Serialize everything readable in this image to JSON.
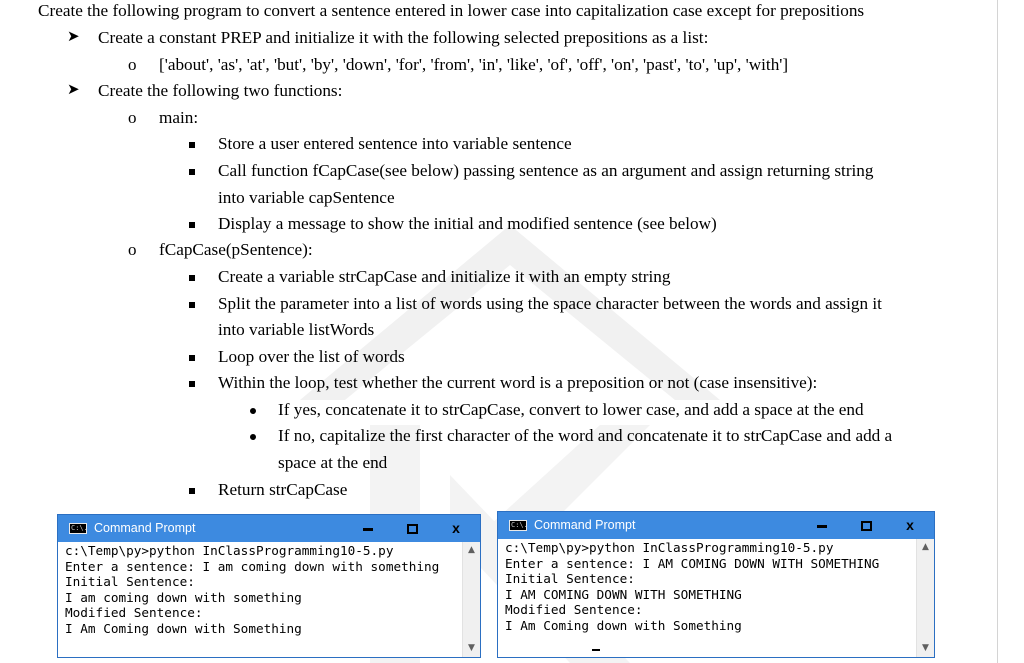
{
  "heading": "Create the following program to convert a sentence entered in lower case into capitalization case except for prepositions",
  "steps": [
    "Create a constant PREP and initialize it with the following selected prepositions as a list:",
    "Create the following two functions:"
  ],
  "prep_list": "['about', 'as', 'at', 'but', 'by', 'down', 'for', 'from', 'in', 'like', 'of', 'off', 'on', 'past', 'to', 'up', 'with']",
  "main": {
    "title": "main:",
    "items": [
      "Store a user entered sentence into variable sentence",
      "Call function fCapCase(see below) passing sentence as an argument and assign returning string",
      "into variable capSentence",
      "Display a message to show the initial and modified sentence (see below)"
    ]
  },
  "fcap": {
    "title": "fCapCase(pSentence):",
    "items": [
      "Create a variable strCapCase and initialize it with an empty string",
      "Split the parameter into a list of words using the space character between the words and assign it",
      "into variable listWords",
      "Loop over the list of words",
      "Within the loop, test whether the current word is a preposition or not (case insensitive):",
      "Return strCapCase"
    ],
    "sub": [
      "If yes, concatenate it to strCapCase, convert to lower case, and add a space at the end",
      "If no, capitalize the first character of the word and concatenate it to strCapCase and add a",
      "space at the end"
    ]
  },
  "console_left": {
    "title": "Command Prompt",
    "icon_text": "C:\\.",
    "lines": [
      "c:\\Temp\\py>python InClassProgramming10-5.py",
      "Enter a sentence: I am coming down with something",
      "Initial Sentence:",
      "I am coming down with something",
      "Modified Sentence:",
      "I Am Coming down with Something"
    ]
  },
  "console_right": {
    "title": "Command Prompt",
    "icon_text": "C:\\.",
    "lines": [
      "c:\\Temp\\py>python InClassProgramming10-5.py",
      "Enter a sentence: I AM COMING DOWN WITH SOMETHING",
      "Initial Sentence:",
      "I AM COMING DOWN WITH SOMETHING",
      "Modified Sentence:",
      "I Am Coming down with Something"
    ]
  },
  "window_buttons": {
    "close": "x"
  },
  "colors": {
    "titlebar": "#3d8ae0",
    "console_bg": "#ffffff",
    "watermark": "#ececec"
  }
}
